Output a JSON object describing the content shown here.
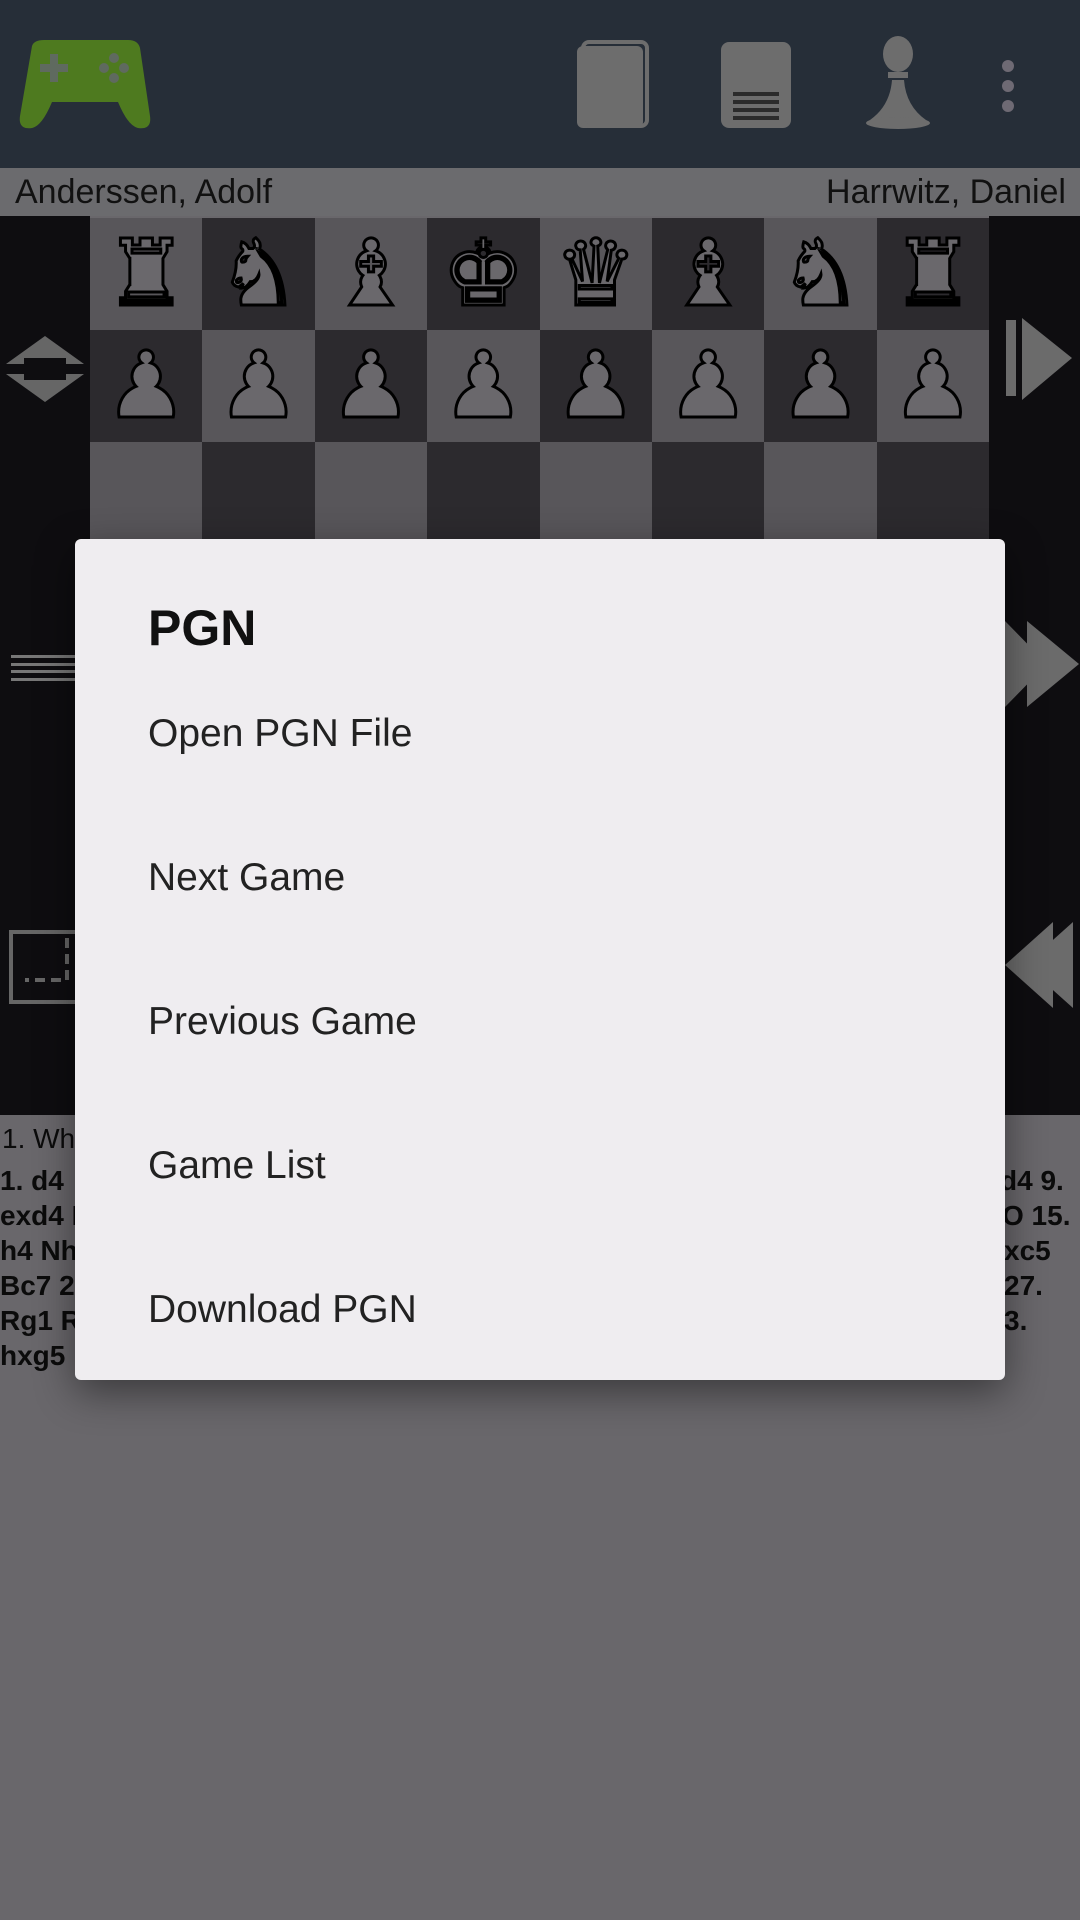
{
  "toolbar": {
    "app_icon": "gamepad-icon",
    "icons": [
      "book-icon",
      "document-icon",
      "pawn-icon",
      "more-vert-icon"
    ],
    "app_icon_color": "#4e7a1f"
  },
  "players": {
    "white": "Anderssen, Adolf",
    "black": "Harrwitz, Daniel"
  },
  "board": {
    "rank8": [
      "♜",
      "♞",
      "♝",
      "♚",
      "♛",
      "♝",
      "♞",
      "♜"
    ],
    "rank7": [
      "♟",
      "♟",
      "♟",
      "♟",
      "♟",
      "♟",
      "♟",
      "♟"
    ]
  },
  "left_controls": [
    "flip-board-icon",
    "menu-lines-icon",
    "resize-board-icon"
  ],
  "right_controls": [
    "step-forward-icon",
    "fast-forward-icon",
    "rewind-icon"
  ],
  "moves": {
    "header": "1. Wh",
    "lines_left": [
      "1. d4",
      "exd4 N",
      "h4 Nh",
      "Bc7 2",
      "Rg1 R",
      "hxg5"
    ],
    "lines_right": [
      "d4 9.",
      "O 15.",
      "xc5",
      "27.",
      "3."
    ]
  },
  "dialog": {
    "title": "PGN",
    "items": [
      "Open PGN File",
      "Next Game",
      "Previous Game",
      "Game List",
      "Download PGN"
    ]
  },
  "colors": {
    "topbar": "#262e38",
    "dialog_bg": "#efedf0",
    "scrim_bg": "#69676b"
  }
}
